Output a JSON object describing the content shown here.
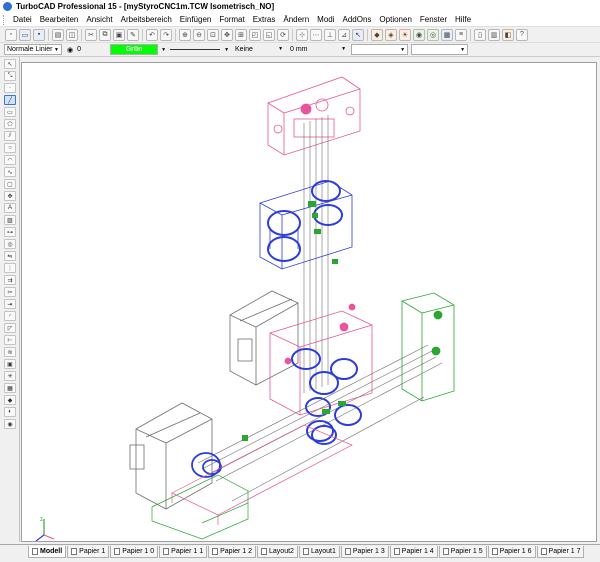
{
  "window": {
    "title": "TurboCAD Professional 15 - [myStyroCNC1m.TCW Isometrisch_NO]"
  },
  "menu": [
    "Datei",
    "Bearbeiten",
    "Ansicht",
    "Arbeitsbereich",
    "Einfügen",
    "Format",
    "Extras",
    "Ändern",
    "Modi",
    "AddOns",
    "Optionen",
    "Fenster",
    "Hilfe"
  ],
  "properties_bar": {
    "line_style": "Normale Linier",
    "layer_value": "0",
    "color_name": "Grün",
    "pattern": "Keine",
    "width": "0 mm"
  },
  "tabs": [
    "Modell",
    "Papier 1",
    "Papier 1 0",
    "Papier 1 1",
    "Papier 1 2",
    "Layout2",
    "Layout1",
    "Papier 1 3",
    "Papier 1 4",
    "Papier 1 5",
    "Papier 1 6",
    "Papier 1 7"
  ],
  "colors": {
    "canvas_bg": "#ffffff",
    "color_swatch": "#00ff00",
    "wire_pink": "#e8559a",
    "wire_blue": "#2c3cd8",
    "wire_green": "#2aa632",
    "wire_gray": "#6e6e6e"
  },
  "icons": {
    "toolbar": [
      "new-icon",
      "open-icon",
      "save-icon",
      "print-icon",
      "preview-icon",
      "cut-icon",
      "copy-icon",
      "paste-icon",
      "undo-icon",
      "redo-icon",
      "zoom-icon",
      "pan-icon",
      "snap-icon",
      "render-icon"
    ],
    "tools": [
      "select-icon",
      "node-edit-icon",
      "point-icon",
      "line-icon",
      "rectangle-icon",
      "polygon-icon",
      "circle-icon",
      "arc-icon",
      "curve-icon",
      "text-icon",
      "hatch-icon",
      "dimension-icon",
      "mirror-icon",
      "layer-icon"
    ]
  }
}
